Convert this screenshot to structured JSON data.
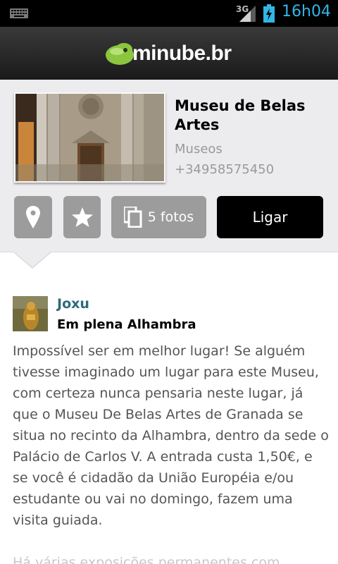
{
  "status_bar": {
    "network": "3G",
    "time": "16h04",
    "icons": [
      "keyboard-icon",
      "signal-icon",
      "battery-charging-icon"
    ]
  },
  "app": {
    "logo_text": "minube.br"
  },
  "place": {
    "name": "Museu de Belas Artes",
    "category": "Museos",
    "phone": "+34958575450",
    "actions": {
      "map_icon": "map-pin-icon",
      "favorite_icon": "star-icon",
      "photos_label": "5 fotos",
      "call_label": "Ligar"
    }
  },
  "review": {
    "author": "Joxu",
    "title": "Em plena Alhambra",
    "body": "Impossível ser em melhor lugar! Se alguém tivesse imaginado um lugar para este Museu, com certeza nunca  pensaria neste lugar, já que o Museu De Belas Artes de Granada se situa no recinto da Alhambra, dentro da sede o Palácio de Carlos V. A entrada custa 1,50€, e se você é cidadão da União Européia e/ou estudante ou vai no domingo, fazem uma visita guiada.",
    "more": "Há várias exposições permanentes com"
  },
  "colors": {
    "accent_blue": "#33b5e5",
    "logo_green": "#8cc63f",
    "author_color": "#2e6a7a"
  }
}
